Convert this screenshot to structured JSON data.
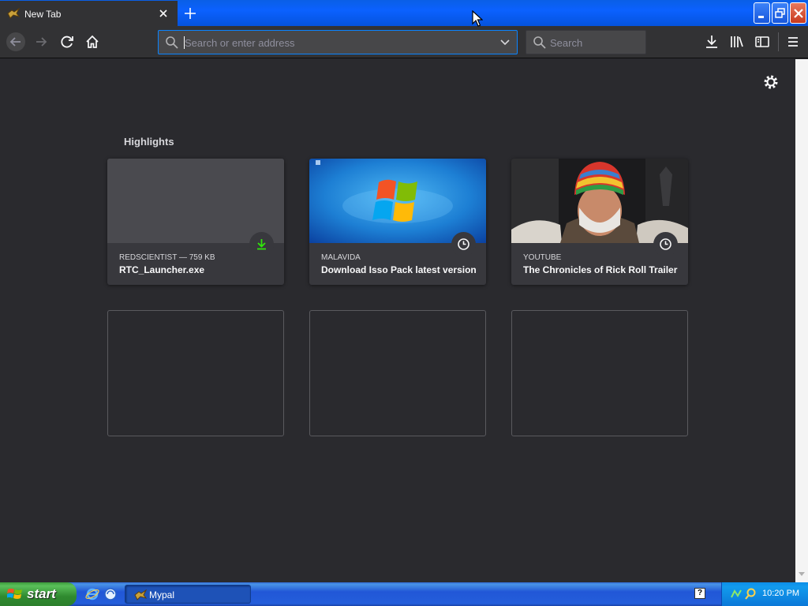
{
  "window": {
    "tab_title": "New Tab",
    "tab_favicon": "mypal-icon",
    "close_tab_icon": "close-icon",
    "new_tab_icon": "plus-icon",
    "controls": [
      "minimize-icon",
      "restore-icon",
      "close-icon"
    ]
  },
  "toolbar": {
    "back_icon": "arrow-left-icon",
    "forward_icon": "arrow-right-icon",
    "reload_icon": "reload-icon",
    "home_icon": "home-icon",
    "url_placeholder": "Search or enter address",
    "url_value": "",
    "search_placeholder": "Search",
    "right_icons": [
      "download-icon",
      "library-icon",
      "sidebar-icon",
      "menu-icon"
    ]
  },
  "content": {
    "settings_icon": "gear-icon",
    "section_title": "Highlights",
    "highlights": [
      {
        "source": "REDSCIENTIST — 759 KB",
        "title": "RTC_Launcher.exe",
        "badge": "download-icon"
      },
      {
        "source": "MALAVIDA",
        "title": "Download Isso Pack latest version",
        "badge": "clock-icon"
      },
      {
        "source": "YOUTUBE",
        "title": "The Chronicles of Rick Roll Trailer",
        "badge": "clock-icon"
      }
    ],
    "empty_slots": 3
  },
  "taskbar": {
    "start_label": "start",
    "quick_launch": [
      "internet-explorer-icon",
      "browser-icon"
    ],
    "task_label": "Mypal",
    "help_label": "?",
    "tray_icons": [
      "network-icon",
      "search-icon"
    ],
    "clock": "10:20 PM"
  },
  "colors": {
    "page_bg": "#2a2a2e",
    "toolbar_bg": "#323234",
    "card_bg": "#38383d",
    "accent": "#0a84ff",
    "download_green": "#30e60b"
  }
}
